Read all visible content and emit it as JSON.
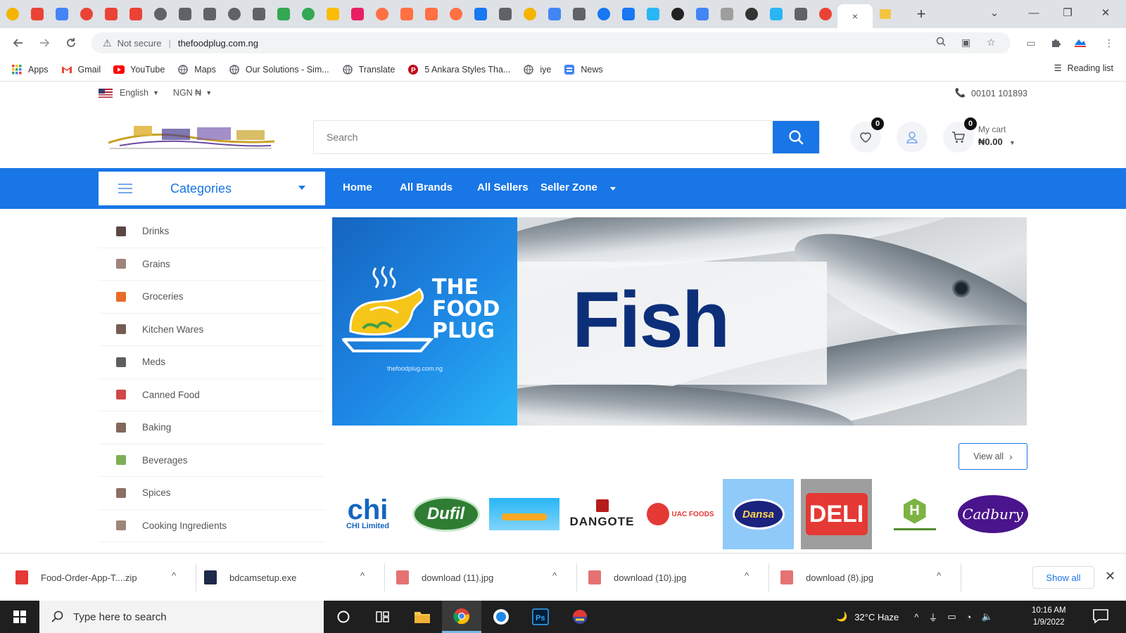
{
  "browser": {
    "active_tab_close": "×",
    "new_tab": "+",
    "window_controls": {
      "minimize": "—",
      "restore": "❐",
      "close": "✕",
      "tab_search": "⌄"
    },
    "tab_favicons": [
      "#f4b400",
      "#ea4335",
      "#4285f4",
      "#ea4335",
      "#ea4335",
      "#ea4335",
      "#5f6368",
      "#5f6368",
      "#5f6368",
      "#5f6368",
      "#5f6368",
      "#34a853",
      "#34a853",
      "#fbbc05",
      "#e91e63",
      "#ff7043",
      "#ff7043",
      "#ff7043",
      "#ff7043",
      "#1877f2",
      "#5f6368",
      "#f4b400",
      "#4285f4",
      "#5f6368",
      "#1877f2",
      "#1877f2",
      "#29b6f6",
      "#222222",
      "#4285f4",
      "#9e9e9e",
      "#333333",
      "#29b6f6",
      "#5f6368",
      "#ea4335"
    ],
    "address": {
      "security": "Not secure",
      "url": "thefoodplug.com.ng"
    },
    "bookmarks": [
      {
        "label": "Apps",
        "icon": "apps-grid-icon",
        "color": "#4285f4"
      },
      {
        "label": "Gmail",
        "icon": "gmail-icon",
        "color": "#ea4335"
      },
      {
        "label": "YouTube",
        "icon": "youtube-icon",
        "color": "#ff0000"
      },
      {
        "label": "Maps",
        "icon": "globe-icon",
        "color": "#5f6368"
      },
      {
        "label": "Our Solutions - Sim...",
        "icon": "globe-icon",
        "color": "#5f6368"
      },
      {
        "label": "Translate",
        "icon": "globe-icon",
        "color": "#5f6368"
      },
      {
        "label": "5 Ankara Styles Tha...",
        "icon": "pinterest-icon",
        "color": "#bd081c"
      },
      {
        "label": "iye",
        "icon": "globe-icon",
        "color": "#5f6368"
      },
      {
        "label": "News",
        "icon": "news-icon",
        "color": "#4285f4"
      }
    ],
    "reading_list": "Reading list"
  },
  "site": {
    "language": "English",
    "currency": "NGN ₦",
    "phone": "00101 101893",
    "search_placeholder": "Search",
    "wishlist_count": "0",
    "cart_count": "0",
    "cart_label": "My cart",
    "cart_total": "₦0.00",
    "categories_label": "Categories",
    "nav": [
      "Home",
      "All Brands",
      "All Sellers",
      "Seller Zone"
    ],
    "categories": [
      {
        "label": "Drinks",
        "icon": "drinks-icon"
      },
      {
        "label": "Grains",
        "icon": "grains-icon"
      },
      {
        "label": "Groceries",
        "icon": "groceries-icon"
      },
      {
        "label": "Kitchen Wares",
        "icon": "kitchen-icon"
      },
      {
        "label": "Meds",
        "icon": "meds-icon"
      },
      {
        "label": "Canned Food",
        "icon": "canned-food-icon"
      },
      {
        "label": "Baking",
        "icon": "baking-icon"
      },
      {
        "label": "Beverages",
        "icon": "beverages-icon"
      },
      {
        "label": "Spices",
        "icon": "spices-icon"
      },
      {
        "label": "Cooking Ingredients",
        "icon": "cooking-icon"
      }
    ],
    "banner": {
      "headline": "Fish",
      "brand_line1": "THE",
      "brand_line2": "FOOD",
      "brand_line3": "PLUG",
      "domain": "thefoodplug.com.ng"
    },
    "view_all": "View all",
    "brands": [
      {
        "name": "chi",
        "sub": "CHI Limited"
      },
      {
        "name": "Dufil"
      },
      {
        "name": ""
      },
      {
        "name": "DANGOTE"
      },
      {
        "name": "UAC FOODS"
      },
      {
        "name": "Dansa"
      },
      {
        "name": "DELI"
      },
      {
        "name": "H"
      },
      {
        "name": "Cadbury"
      }
    ]
  },
  "downloads": {
    "items": [
      {
        "name": "Food-Order-App-T....zip",
        "color": "#e53935"
      },
      {
        "name": "bdcamsetup.exe",
        "color": "#1e2a4a"
      },
      {
        "name": "download (11).jpg",
        "color": "#e57373"
      },
      {
        "name": "download (10).jpg",
        "color": "#e57373"
      },
      {
        "name": "download (8).jpg",
        "color": "#e57373"
      }
    ],
    "show_all": "Show all",
    "close": "✕"
  },
  "taskbar": {
    "search_placeholder": "Type here to search",
    "weather": "32°C  Haze",
    "time": "10:16 AM",
    "date": "1/9/2022"
  },
  "colors": {
    "primary": "#1976e6",
    "banner_text": "#0d2f7a"
  }
}
